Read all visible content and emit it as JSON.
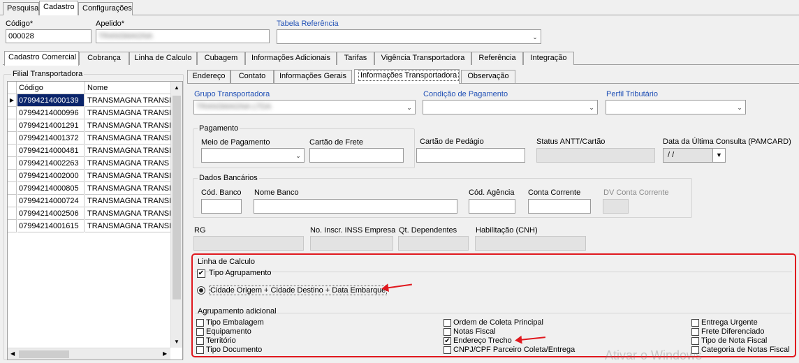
{
  "top_tabs": [
    "Pesquisa",
    "Cadastro",
    "Configurações"
  ],
  "header": {
    "codigo_label": "Código*",
    "codigo_value": "000028",
    "apelido_label": "Apelido*",
    "apelido_value": "TRANSMAGNA",
    "tabela_label": "Tabela Referência"
  },
  "main_tabs": [
    "Cadastro Comercial",
    "Cobrança",
    "Linha de Calculo",
    "Cubagem",
    "Informações Adicionais",
    "Tarifas",
    "Vigência Transportadora",
    "Referência",
    "Integração"
  ],
  "filial": {
    "title": "Filial Transportadora",
    "col_codigo": "Código",
    "col_nome": "Nome",
    "rows": [
      {
        "codigo": "07994214000139",
        "nome": "TRANSMAGNA TRANSP"
      },
      {
        "codigo": "07994214000996",
        "nome": "TRANSMAGNA TRANSP"
      },
      {
        "codigo": "07994214001291",
        "nome": "TRANSMAGNA TRANSP"
      },
      {
        "codigo": "07994214001372",
        "nome": "TRANSMAGNA TRANSP"
      },
      {
        "codigo": "07994214000481",
        "nome": "TRANSMAGNA TRANSP"
      },
      {
        "codigo": "07994214002263",
        "nome": "TRANSMAGNA TRANS"
      },
      {
        "codigo": "07994214002000",
        "nome": "TRANSMAGNA TRANSP"
      },
      {
        "codigo": "07994214000805",
        "nome": "TRANSMAGNA TRANSP"
      },
      {
        "codigo": "07994214000724",
        "nome": "TRANSMAGNA TRANSP"
      },
      {
        "codigo": "07994214002506",
        "nome": "TRANSMAGNA TRANSP"
      },
      {
        "codigo": "07994214001615",
        "nome": "TRANSMAGNA TRANSP"
      }
    ]
  },
  "sub_tabs": [
    "Endereço",
    "Contato",
    "Informações Gerais",
    "Informações Transportadora",
    "Observação"
  ],
  "form": {
    "grupo_label": "Grupo Transportadora",
    "grupo_value": "TRANSMAGNA LTDA",
    "condicao_label": "Condição de Pagamento",
    "perfil_label": "Perfil Tributário",
    "pagamento_title": "Pagamento",
    "meio_label": "Meio de Pagamento",
    "cartao_frete_label": "Cartão de Frete",
    "cartao_pedagio_label": "Cartão de Pedágio",
    "status_antt_label": "Status ANTT/Cartão",
    "data_consulta_label": "Data da Última Consulta (PAMCARD)",
    "data_consulta_value": " / /",
    "dados_bancarios_title": "Dados Bancários",
    "cod_banco_label": "Cód. Banco",
    "nome_banco_label": "Nome Banco",
    "cod_agencia_label": "Cód. Agência",
    "conta_corrente_label": "Conta Corrente",
    "dv_conta_label": "DV Conta Corrente",
    "rg_label": "RG",
    "inss_label": "No. Inscr. INSS Empresa",
    "dependentes_label": "Qt. Dependentes",
    "habilitacao_label": "Habilitação (CNH)"
  },
  "linha_calculo": {
    "title": "Linha de Calculo",
    "tipo_agrupamento": "Tipo Agrupamento",
    "radio_option": "Cidade Origem + Cidade Destino + Data Embarque",
    "agrupamento_title": "Agrupamento adicional",
    "col1": [
      "Tipo Embalagem",
      "Equipamento",
      "Território",
      "Tipo Documento"
    ],
    "col2": [
      "Ordem de Coleta Principal",
      "Notas Fiscal",
      "Endereço Trecho",
      "CNPJ/CPF Parceiro Coleta/Entrega"
    ],
    "col3": [
      "Entrega Urgente",
      "Frete Diferenciado",
      "Tipo de Nota Fiscal",
      "Categoria de Notas Fiscal"
    ]
  },
  "watermark": "Ativar o Windows",
  "colors": {
    "accent_link": "#1f4fb5",
    "highlight": "#e0181e",
    "selection": "#0a246a"
  }
}
